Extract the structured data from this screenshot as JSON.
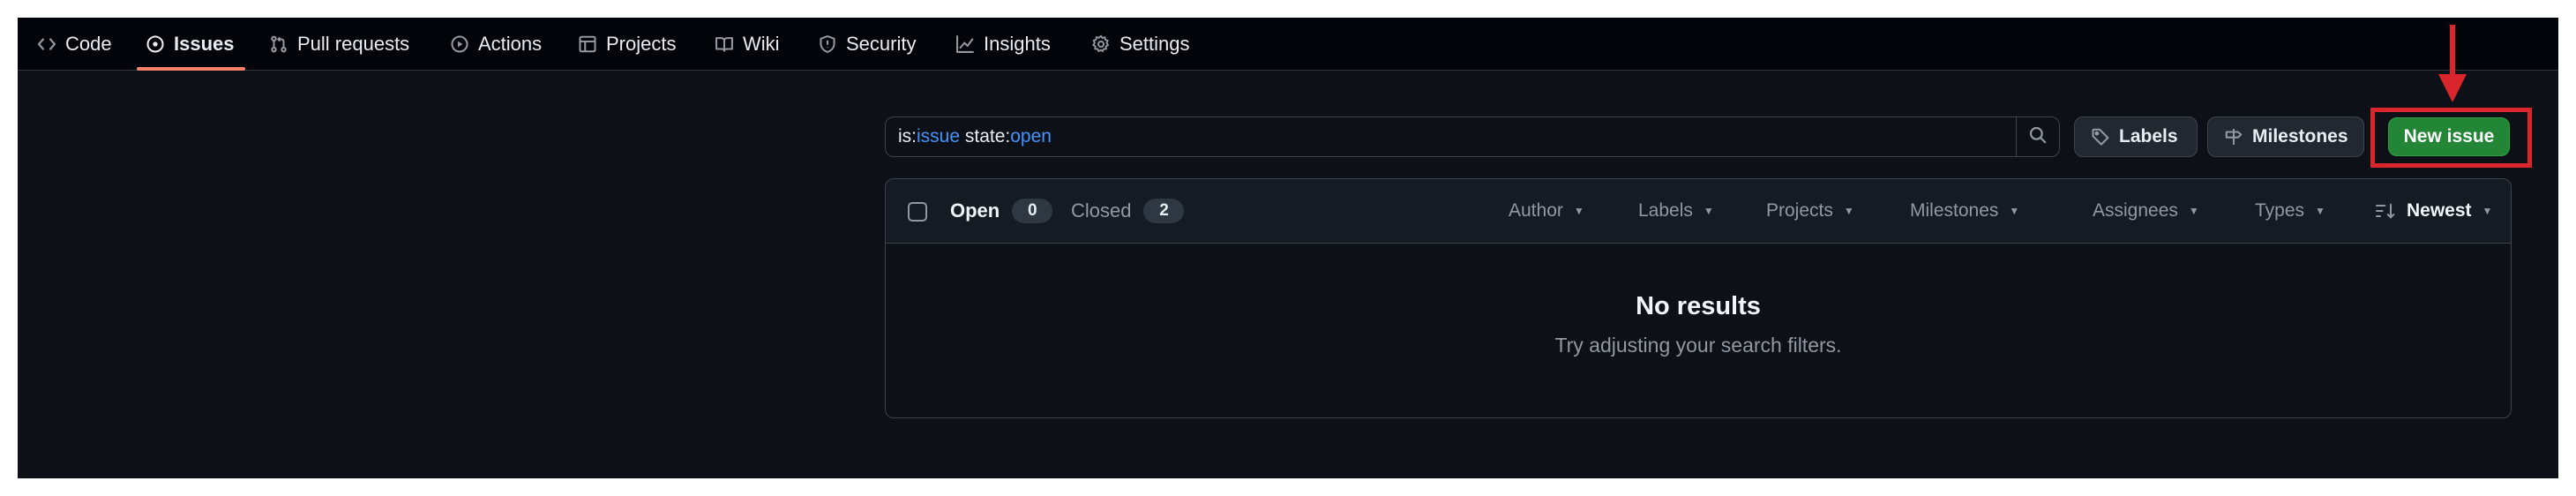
{
  "nav": {
    "items": [
      {
        "label": "Code",
        "icon": "code-icon"
      },
      {
        "label": "Issues",
        "icon": "issue-opened-icon",
        "active": true
      },
      {
        "label": "Pull requests",
        "icon": "git-pull-request-icon"
      },
      {
        "label": "Actions",
        "icon": "play-icon"
      },
      {
        "label": "Projects",
        "icon": "table-icon"
      },
      {
        "label": "Wiki",
        "icon": "book-icon"
      },
      {
        "label": "Security",
        "icon": "shield-icon"
      },
      {
        "label": "Insights",
        "icon": "graph-icon"
      },
      {
        "label": "Settings",
        "icon": "gear-icon"
      }
    ]
  },
  "search": {
    "query_parts": [
      {
        "text": "is:",
        "token": false
      },
      {
        "text": "issue",
        "token": true
      },
      {
        "text": " state:",
        "token": false
      },
      {
        "text": "open",
        "token": true
      }
    ]
  },
  "toolbar": {
    "labels_label": "Labels",
    "milestones_label": "Milestones",
    "new_issue_label": "New issue"
  },
  "list": {
    "open_label": "Open",
    "open_count": "0",
    "closed_label": "Closed",
    "closed_count": "2",
    "filters": [
      "Author",
      "Labels",
      "Projects",
      "Milestones",
      "Assignees",
      "Types"
    ],
    "sort_label": "Newest",
    "empty_title": "No results",
    "empty_subtitle": "Try adjusting your search filters."
  },
  "colors": {
    "background": "#0d1117",
    "nav_background": "#010409",
    "active_underline": "#f78166",
    "primary_button": "#238636",
    "token_blue": "#4493f8",
    "annotation_red": "#d9252b"
  }
}
